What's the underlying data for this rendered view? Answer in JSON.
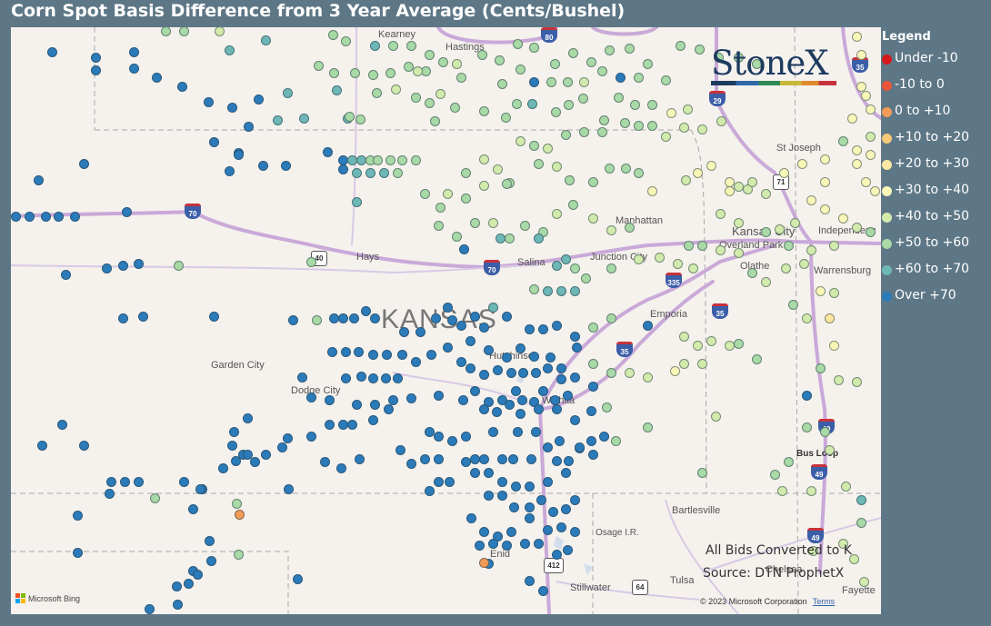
{
  "title": "Corn Spot Basis Difference from 3 Year Average (Cents/Bushel)",
  "logo_text": "StoneX",
  "legend": {
    "title": "Legend",
    "items": [
      {
        "label": "Under -10",
        "color": "#d7191c"
      },
      {
        "label": "-10 to 0",
        "color": "#e8563a"
      },
      {
        "label": "0 to +10",
        "color": "#f39b58"
      },
      {
        "label": "+10 to +20",
        "color": "#f7c878"
      },
      {
        "label": "+20 to +30",
        "color": "#fbe7a2"
      },
      {
        "label": "+30 to +40",
        "color": "#f8f7b8"
      },
      {
        "label": "+40 to +50",
        "color": "#d2ebad"
      },
      {
        "label": "+50 to +60",
        "color": "#a8d9a6"
      },
      {
        "label": "+60 to +70",
        "color": "#6db7b6"
      },
      {
        "label": "Over +70",
        "color": "#2b7bba"
      }
    ]
  },
  "map_labels": {
    "kansas": "KANSAS",
    "hays": "Hays",
    "garden_city": "Garden City",
    "dodge_city": "Dodge City",
    "hutchinson": "Hutchinson",
    "wichita": "Wichita",
    "salina": "Salina",
    "junction_city": "Junction City",
    "manhattan": "Manhattan",
    "emporia": "Emporia",
    "olathe": "Olathe",
    "overland_park": "Overland Park",
    "kansas_city": "Kansas City",
    "independence": "Independenc",
    "st_joseph": "St Joseph",
    "warrensburg": "Warrensburg",
    "hastings": "Hastings",
    "kearney": "Kearney",
    "enid": "Enid",
    "stillwater": "Stillwater",
    "tulsa": "Tulsa",
    "bartlesville": "Bartlesville",
    "osage": "Osage I.R.",
    "bus_loop": "Bus Loop",
    "chelsea": "Chelsea",
    "fayette": "Fayette"
  },
  "shields": {
    "i70_w": "70",
    "i70": "70",
    "i35_ks": "35",
    "i35_ok": "35",
    "i335": "335",
    "i29": "29",
    "i35_mo": "35",
    "i49_a": "49",
    "i49_b": "49",
    "i44": "49",
    "us71": "71",
    "us40": "40",
    "us412": "412",
    "us64": "64",
    "i80": "80"
  },
  "notes": {
    "line1": "All Bids Converted to K",
    "line2": "Source: DTN ProphetX"
  },
  "copyright": "© 2023 Microsoft Corporation",
  "terms": "Terms",
  "bing": "Microsoft Bing",
  "colors": {
    "panel_bg": "#5e7786",
    "map_bg": "#f5f1ed"
  }
}
